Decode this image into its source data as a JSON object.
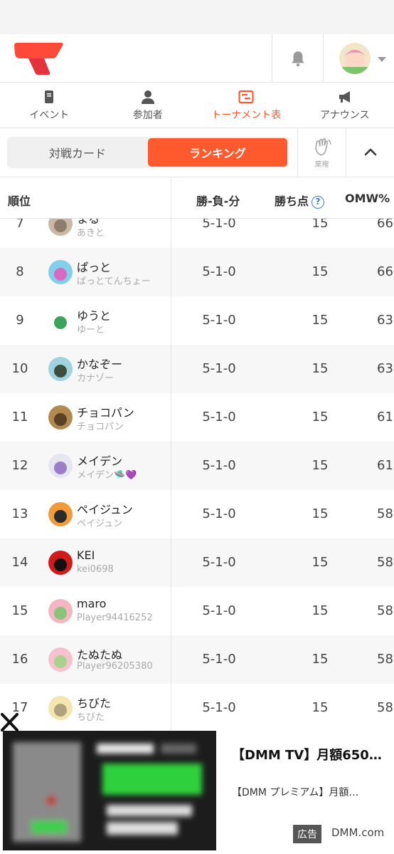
{
  "colors": {
    "accent": "#ff5a2d",
    "help": "#3b7bd4",
    "divider": "#e4e4e4"
  },
  "header": {
    "logo_icon": "brand-logo",
    "bell_icon": "bell-icon",
    "avatar_icon": "user-avatar"
  },
  "nav": {
    "tabs": [
      {
        "label": "イベント",
        "icon": "event-icon",
        "active": false
      },
      {
        "label": "参加者",
        "icon": "person-icon",
        "active": false
      },
      {
        "label": "トーナメント表",
        "icon": "bracket-icon",
        "active": true
      },
      {
        "label": "アナウンス",
        "icon": "megaphone-icon",
        "active": false
      }
    ]
  },
  "subbar": {
    "left_label": "対戦カード",
    "right_label": "ランキング",
    "resign_label": "棄権"
  },
  "table": {
    "headers": {
      "rank": "順位",
      "record": "勝-負-分",
      "points": "勝ち点",
      "omw": "OMW%"
    },
    "rows": [
      {
        "rank": "7",
        "name": "まる",
        "id": "あきと",
        "record": "5-1-0",
        "points": "15",
        "omw": "66"
      },
      {
        "rank": "8",
        "name": "ぱっと",
        "id": "ぱっとてんちょー",
        "record": "5-1-0",
        "points": "15",
        "omw": "66"
      },
      {
        "rank": "9",
        "name": "ゆうと",
        "id": "ゆーと",
        "record": "5-1-0",
        "points": "15",
        "omw": "63"
      },
      {
        "rank": "10",
        "name": "かなぞー",
        "id": "カナゾー",
        "record": "5-1-0",
        "points": "15",
        "omw": "63"
      },
      {
        "rank": "11",
        "name": "チョコパン",
        "id": "チョコパン",
        "record": "5-1-0",
        "points": "15",
        "omw": "61"
      },
      {
        "rank": "12",
        "name": "メイデン",
        "id": "メイデン🛸💜",
        "record": "5-1-0",
        "points": "15",
        "omw": "61"
      },
      {
        "rank": "13",
        "name": "ペイジュン",
        "id": "ペイジュン",
        "record": "5-1-0",
        "points": "15",
        "omw": "58"
      },
      {
        "rank": "14",
        "name": "KEI",
        "id": "kei0698",
        "record": "5-1-0",
        "points": "15",
        "omw": "58"
      },
      {
        "rank": "15",
        "name": "maro",
        "id": "Player94416252",
        "record": "5-1-0",
        "points": "15",
        "omw": "58"
      },
      {
        "rank": "16",
        "name": "たぬたぬ",
        "id": "Player96205380",
        "record": "5-1-0",
        "points": "15",
        "omw": "58"
      },
      {
        "rank": "17",
        "name": "ちびた",
        "id": "ちびた",
        "record": "5-1-0",
        "points": "15",
        "omw": "58"
      }
    ]
  },
  "ad": {
    "title": "【DMM TV】月額650…",
    "description": "【DMM プレミアム】月額…",
    "badge": "広告",
    "domain": "DMM.com"
  }
}
